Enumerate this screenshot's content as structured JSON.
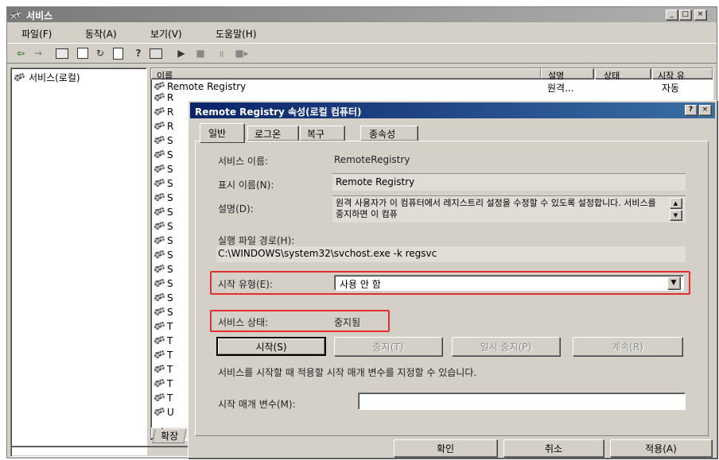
{
  "main_window": {
    "title": "서비스",
    "menu": [
      "파일(F)",
      "동작(A)",
      "보기(V)",
      "도움말(H)"
    ],
    "toolbar_icons": [
      "back-arrow-icon",
      "forward-arrow-icon",
      "console-tree-icon",
      "properties-icon",
      "refresh-icon",
      "export-icon",
      "help-icon",
      "console-icon",
      "play-icon",
      "stop-icon",
      "pause-icon",
      "restart-icon"
    ],
    "tree_root": "서비스(로컬)",
    "columns": [
      "이름",
      "설명",
      "상태",
      "시작 유"
    ],
    "first_row": {
      "name": "Remote Registry",
      "desc": "원격...",
      "startup": "자동"
    },
    "row_letters": [
      "R",
      "R",
      "R",
      "S",
      "S",
      "S",
      "S",
      "S",
      "S",
      "S",
      "S",
      "S",
      "S",
      "S",
      "S",
      "S",
      "T",
      "T",
      "T",
      "T",
      "T",
      "T",
      "U"
    ],
    "tab_label": "확장"
  },
  "dialog": {
    "title": "Remote Registry 속성(로컬 컴퓨터)",
    "help_glyph": "?",
    "close_glyph": "×",
    "tabs": [
      "일반",
      "로그온",
      "복구",
      "종속성"
    ],
    "service_name_label": "서비스 이름:",
    "service_name_value": "RemoteRegistry",
    "display_name_label": "표시 이름(N):",
    "display_name_value": "Remote Registry",
    "description_label": "설명(D):",
    "description_value": "원격 사용자가 이 컴퓨터에서 레지스트리 설정을 수정할 수 있도록 설정합니다. 서비스를 중지하면 이 컴퓨",
    "exe_path_label": "실행 파일 경로(H):",
    "exe_path_value": "C:\\WINDOWS\\system32\\svchost.exe -k regsvc",
    "startup_type_label": "시작 유형(E):",
    "startup_type_value": "사용 안 함",
    "service_status_label": "서비스 상태:",
    "service_status_value": "중지됨",
    "start_button": "시작(S)",
    "stop_button": "중지(T)",
    "pause_button": "일시 중지(P)",
    "resume_button": "계속(R)",
    "hint_text": "서비스를 시작할 때 적용할 시작 매개 변수를 지정할 수 있습니다.",
    "start_params_label": "시작 매개 변수(M):",
    "start_params_value": "",
    "ok_button": "확인",
    "cancel_button": "취소",
    "apply_button": "적용(A)"
  },
  "colors": {
    "face": "#d4d0c8",
    "titlebar_inactive": "#808080",
    "titlebar_active": "#0a246a",
    "highlight_box": "#e23030"
  }
}
